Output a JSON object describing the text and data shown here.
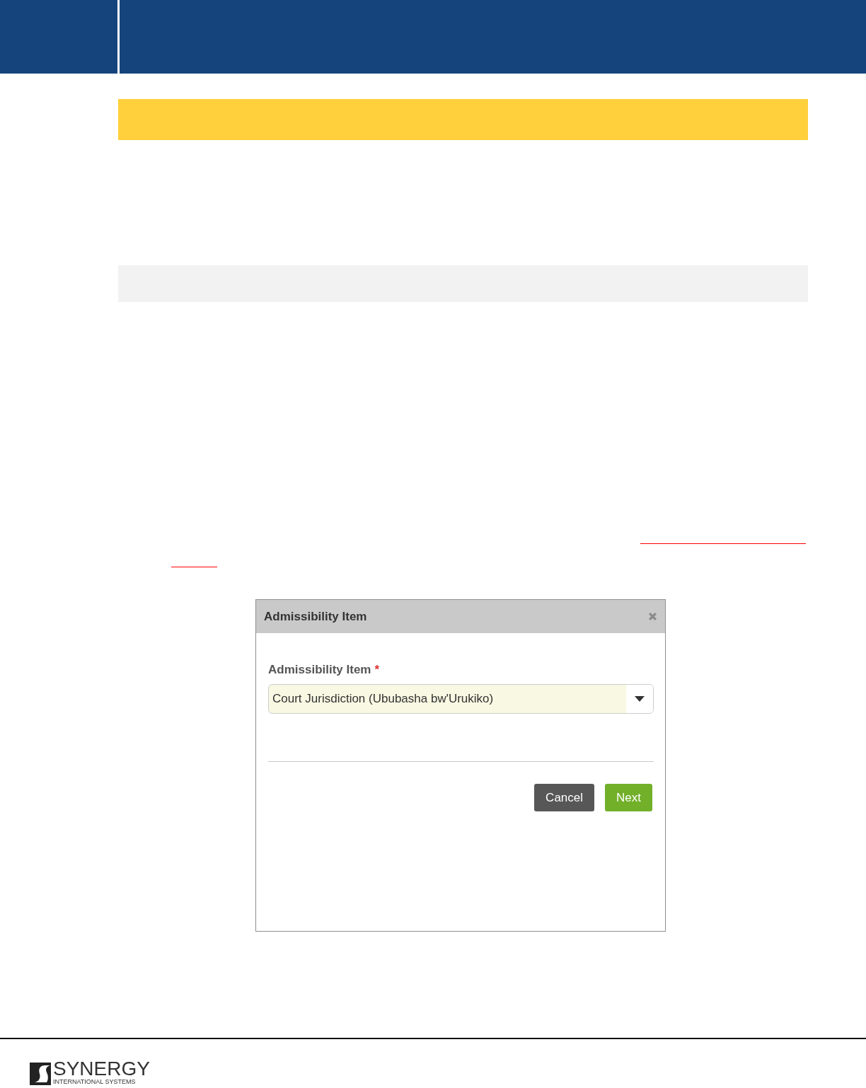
{
  "dialog": {
    "title": "Admissibility Item",
    "field": {
      "label": "Admissibility Item",
      "required_mark": "*",
      "value": "Court Jurisdiction (Ububasha bw'Urukiko)"
    },
    "buttons": [
      {
        "label": "Cancel",
        "kind": "secondary"
      },
      {
        "label": "Next",
        "kind": "primary"
      }
    ]
  },
  "footer": {
    "logo_name": "SYNERGY",
    "logo_tagline": "INTERNATIONAL SYSTEMS"
  }
}
